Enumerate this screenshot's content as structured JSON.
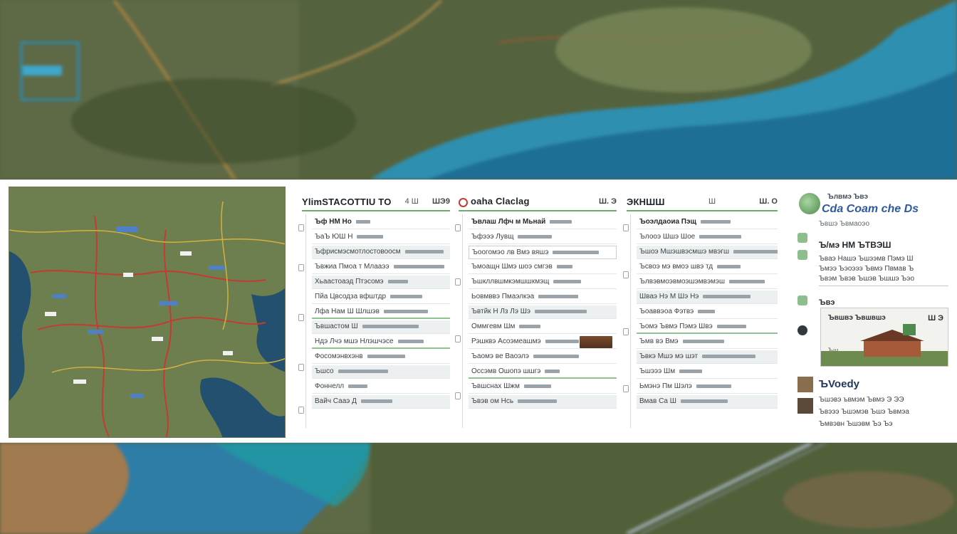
{
  "colors": {
    "accent_green": "#6ab06c",
    "route_red": "#c33b32",
    "route_yellow": "#d4b13a",
    "link_blue": "#2c5aa0"
  },
  "map": {
    "icon": "map-icon"
  },
  "columns": [
    {
      "title": "YlimSTACOTTIU TO",
      "mid": "4 Ш",
      "ctrl": "ШЭ9",
      "rows": [
        {
          "label": "Ъф НМ Но",
          "style": "bold"
        },
        {
          "label": "ЪаЪ ЮШ Н",
          "style": ""
        },
        {
          "label": "Ъфрисмэсмотлостовоосм",
          "style": "shaded"
        },
        {
          "label": "Ъвжиа Пмоа т Млааээ",
          "style": ""
        },
        {
          "label": "Хьаастоаэд Птэсомэ",
          "style": "shaded"
        },
        {
          "label": "Пйа Цвсодза вфштдр",
          "style": ""
        },
        {
          "label": "Лфа Нам Ш Шлшэв",
          "style": "green"
        },
        {
          "label": "Ъвшастом Ш",
          "style": "shaded"
        },
        {
          "label": "Ндэ Лчэ мшэ Нлэшчэсе",
          "style": "green"
        },
        {
          "label": "Фосомэнвхэнв",
          "style": ""
        },
        {
          "label": "Ъшсо",
          "style": "shaded"
        },
        {
          "label": "Фоннелл",
          "style": ""
        },
        {
          "label": "Вайч Сааэ Д",
          "style": "shaded"
        }
      ]
    },
    {
      "title": "oaha Claclag",
      "mid": "",
      "ctrl": "Ш. Э",
      "rows": [
        {
          "label": "Ъвлаш Лфч м Мьнай",
          "style": "bold"
        },
        {
          "label": "Ъфэээ Лувщ",
          "style": ""
        },
        {
          "label": "Ъоогомэо лв Вмэ вяшэ",
          "style": "outlined"
        },
        {
          "label": "Ъмоащн Шмэ шоэ смгэв",
          "style": ""
        },
        {
          "label": "Ъшкллвшмкэмшшкмэщ",
          "style": ""
        },
        {
          "label": "Ьовмввэ Пмаэлкэа",
          "style": ""
        },
        {
          "label": "Ъвтйк Н Лз Лэ Шэ",
          "style": "shaded"
        },
        {
          "label": "Оммгевм Шм",
          "style": ""
        },
        {
          "label": "Рэшквэ Асоэмеашмэ",
          "style": "thumb"
        },
        {
          "label": "Ъаомэ ве Ваоэлэ",
          "style": ""
        },
        {
          "label": "Оссэмв Ошопэ шшгэ",
          "style": "green"
        },
        {
          "label": "Ъвшснах Шжм",
          "style": ""
        },
        {
          "label": "Ъвэв ом Нсь",
          "style": "shaded"
        }
      ]
    },
    {
      "title": "ЭКНШШ",
      "mid": "Ш",
      "ctrl": "Ш. О",
      "rows": [
        {
          "label": "Ъоэлдаоиа Пэщ",
          "style": "bold"
        },
        {
          "label": "Ълооэ Шшэ Шое",
          "style": ""
        },
        {
          "label": "Ъшоэ Мшэшвэсмшэ мвэгш",
          "style": "shaded"
        },
        {
          "label": "Ъсвоэ мэ вмоэ швэ тд",
          "style": ""
        },
        {
          "label": "Ълвэвмоэвмоэшэмвэмэш",
          "style": ""
        },
        {
          "label": "Шваэ Нэ М Шэ Нэ",
          "style": "shaded"
        },
        {
          "label": "Ъоаввэоа Фэтвэ",
          "style": ""
        },
        {
          "label": "Ъомэ Ъвмэ Пэмэ Швэ",
          "style": "green"
        },
        {
          "label": "Ъмв вэ Вмэ",
          "style": ""
        },
        {
          "label": "Ъвкэ Мшэ мэ шэт",
          "style": "shaded"
        },
        {
          "label": "Ъшэээ Шм",
          "style": ""
        },
        {
          "label": "Ьмэнэ Пм Шэлэ",
          "style": ""
        },
        {
          "label": "Вмав Са Ш",
          "style": "shaded"
        }
      ]
    }
  ],
  "side": {
    "small_top": "Ълвмэ Ъвэ",
    "heading": "Cda Coam che Ds",
    "sub": "Ъвшэ Ъвмаоэо",
    "section": "Ъ/мэ НМ ЪТВЭШ",
    "lines": [
      "Ъваэ Нашэ Ъшээмв Пэмэ Ш",
      "Ъмээ Ъэоэээ Ъвмэ Пвмав Ъ",
      "Ъвэм Ъвэв Ъшэв Ъшшэ Ъэо"
    ],
    "label": "Ъвэ",
    "photo_caption": "Ъвшвэ Ъвшвшэ",
    "photo_num": "Ш Э",
    "photo_tag": "Ъш",
    "title2": "ЪVoedy",
    "lines2": [
      "Ъшэвэ ъвмэм Ъвмэ Э ЭЭ",
      "Ъвэээ Ъшэмэв Ъшэ Ъвмэа",
      "Ъмвэвн Ъшэвм Ъэ Ъэ"
    ]
  }
}
